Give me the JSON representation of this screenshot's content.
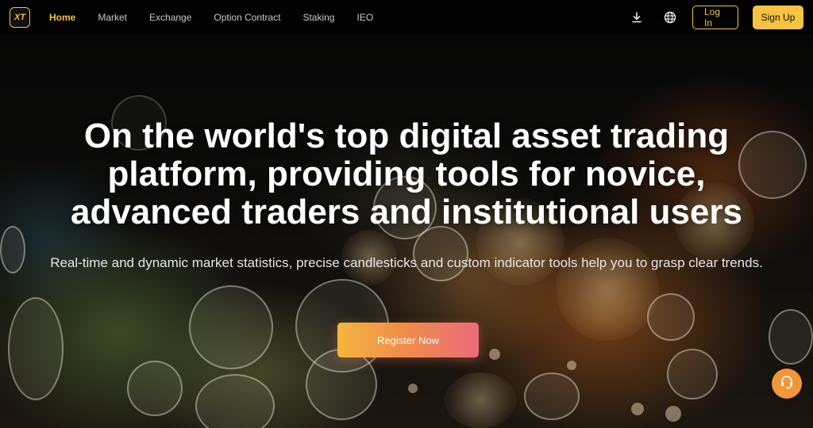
{
  "header": {
    "logo_text": "XT",
    "nav": [
      {
        "label": "Home",
        "active": true
      },
      {
        "label": "Market",
        "active": false
      },
      {
        "label": "Exchange",
        "active": false
      },
      {
        "label": "Option Contract",
        "active": false
      },
      {
        "label": "Staking",
        "active": false
      },
      {
        "label": "IEO",
        "active": false
      }
    ],
    "icons": [
      "download-icon",
      "globe-icon"
    ],
    "login_label": "Log In",
    "signup_label": "Sign Up"
  },
  "hero": {
    "title": "On the world's top digital asset trading platform, providing tools for novice, advanced traders and institutional users",
    "subtitle": "Real-time and dynamic market statistics, precise candlesticks and custom indicator tools help you to grasp clear trends.",
    "cta_label": "Register Now"
  },
  "support": {
    "icon": "headset-icon"
  },
  "colors": {
    "accent": "#f5c242",
    "cta_gradient_start": "#f4b53f",
    "cta_gradient_end": "#ec6a7a",
    "support_bg": "#f2963a",
    "background": "#050506"
  }
}
